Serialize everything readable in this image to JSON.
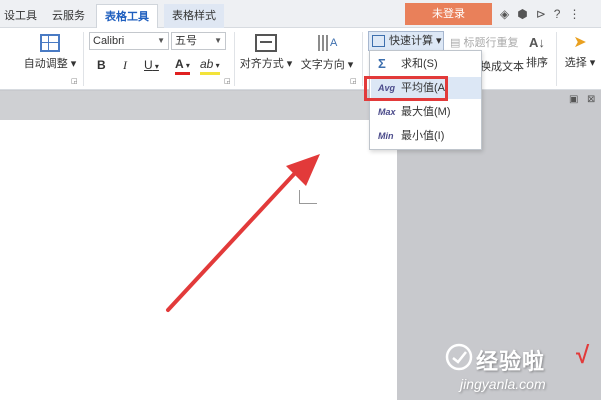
{
  "tabs": {
    "t0": "设工具",
    "t1": "云服务",
    "t2": "表格工具",
    "t3": "表格样式",
    "login": "未登录"
  },
  "ribbon": {
    "auto_adjust": "自动调整",
    "font_name": "Calibri",
    "font_size": "五号",
    "bold": "B",
    "italic": "I",
    "underline": "U",
    "font_color": "A",
    "align": "对齐方式",
    "text_dir": "文字方向",
    "quick_calc": "快速计算",
    "title_row_repeat": "标题行重复",
    "to_text": "换成文本",
    "sort": "排序",
    "select": "选择"
  },
  "menu": {
    "items": [
      {
        "icon": "Σ",
        "label": "求和(S)"
      },
      {
        "icon": "Avg",
        "label": "平均值(A)"
      },
      {
        "icon": "Max",
        "label": "最大值(M)"
      },
      {
        "icon": "Min",
        "label": "最小值(I)"
      }
    ]
  },
  "watermark": {
    "main": "经验啦",
    "check": "√",
    "sub": "jingyanla.com"
  },
  "colors": {
    "accent": "#e9805a",
    "highlight_border": "#e23a3a",
    "arrow": "#e23a3a",
    "menu_hover": "#dce7f5"
  }
}
